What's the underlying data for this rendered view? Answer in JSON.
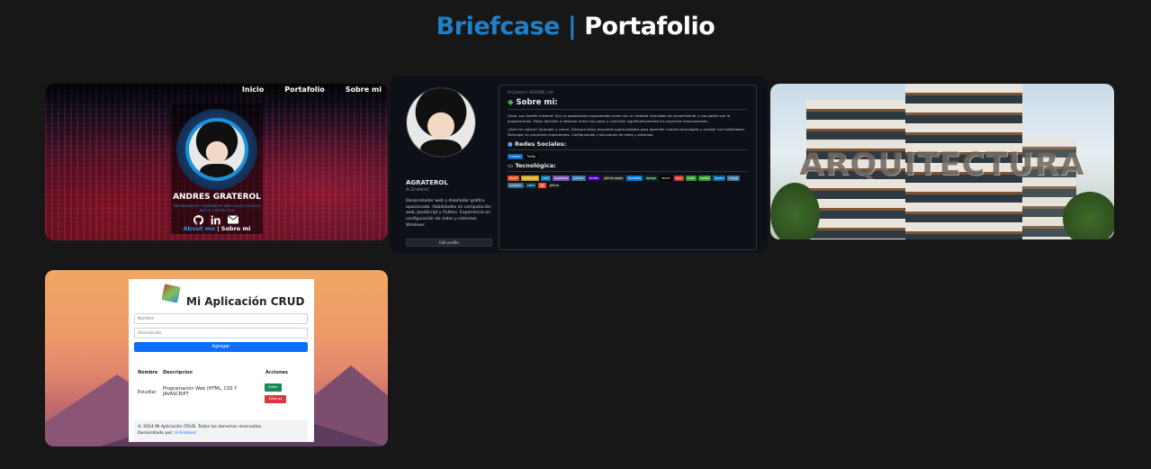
{
  "header": {
    "title_accent": "Briefcase",
    "separator": "|",
    "title_main": "Portafolio"
  },
  "cards": [
    {
      "nav": [
        "Inicio",
        "Portafolio",
        "Sobre mi"
      ],
      "name": "ANDRES GRATEROL",
      "subtitle": "PROGRAMADOR Y DISEÑADOR WEB / BUSCO NUEVOS RETOS Y PROYECTOS",
      "icons": [
        "github-icon",
        "linkedin-icon",
        "mail-icon"
      ],
      "link_about": "About me",
      "link_sep": "|",
      "link_sobre": "Sobre mi"
    },
    {
      "name": "AGRATEROL",
      "handle": "A-Graterol",
      "bio": "Desarrollador web y diseñador gráfico apasionado. Habilidades en computación web, JavaScript y Python. Experiencia en configuración de redes y sistemas Windows.",
      "edit": "Edit profile",
      "path": "A-Graterol / README .md",
      "h_sobre": "Sobre mi:",
      "p_sobre": "¡Hola, soy Andrés Graterol! Soy un apasionado programador joven con un hambre insaciable de conocimiento y una pasión por la programación. Estoy decidido a destacar entre mis pares y contribuir significativamente en proyectos emocionantes.",
      "p_quehago": "¿Qué me motiva? Aprender y crecer: Siempre estoy buscando oportunidades para aprender nuevas tecnologías y ampliar mis habilidades. Participar en proyectos impactantes. Configuración y soluciones de redes y sistemas.",
      "h_redes": "Redes Sociales:",
      "redes": [
        "LinkedIn",
        "TikTok"
      ],
      "h_tec": "Tecnológica:",
      "badges": [
        "html5",
        "javascript",
        "css3",
        "bootstrap",
        "python",
        "heroku",
        "github pages",
        "windows",
        "django",
        "vercel",
        "npm",
        "node",
        "nodejs",
        "jquery",
        "mysql",
        "postgres",
        "sqlite",
        "git",
        "github"
      ]
    },
    {
      "overlay": "ARQUITECTURA"
    },
    {
      "title": "Mi Aplicación CRUD",
      "name_placeholder": "Nombre",
      "desc_placeholder": "Descripción",
      "add": "Agregar",
      "th_nombre": "Nombre",
      "th_desc": "Descripcion",
      "th_acc": "Acciones",
      "row_nombre": "Estudiar",
      "row_desc": "Programación Web (HTML, CSS Y JAVASCRIPT",
      "btn_edit": "Editar",
      "btn_del": "Eliminar",
      "footer_copy": "© 2024 Mi Aplicación CRUD. Todos los derechos reservados.",
      "footer_dev": "Desarrollado por:",
      "footer_link": "A-Graterol"
    }
  ],
  "colors": {
    "accent": "#1f7fc8",
    "background": "#171717"
  }
}
